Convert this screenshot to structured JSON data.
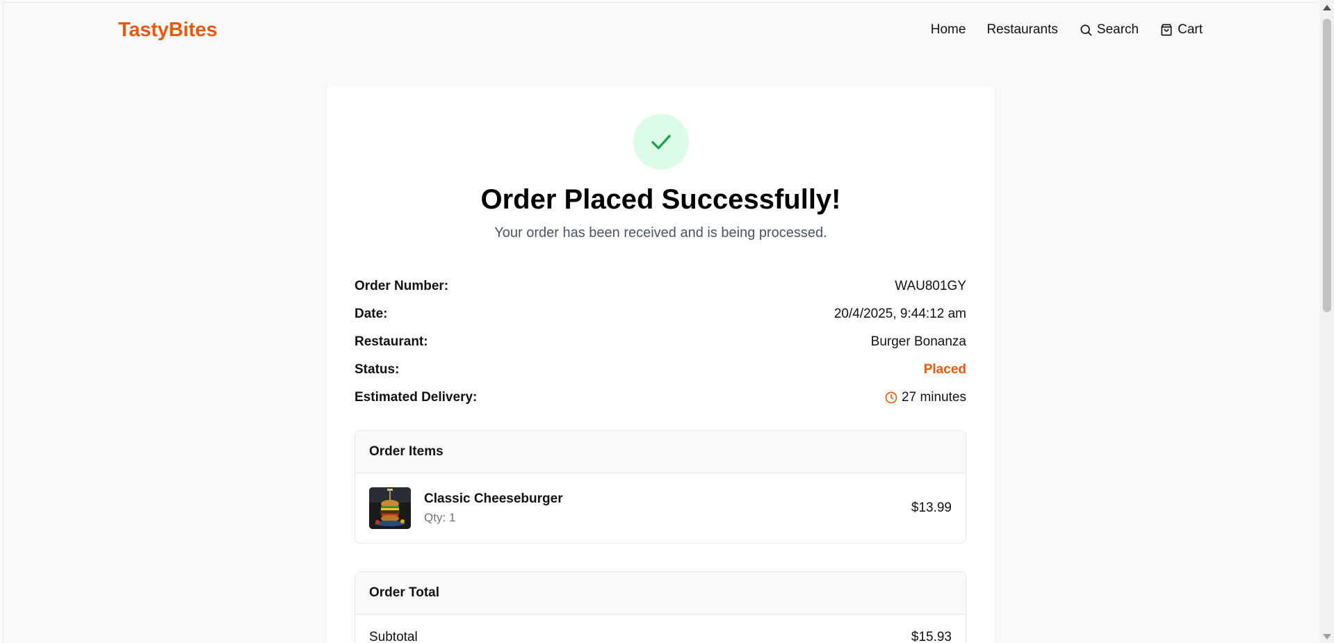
{
  "header": {
    "brand": "TastyBites",
    "nav": [
      {
        "label": "Home",
        "icon": ""
      },
      {
        "label": "Restaurants",
        "icon": ""
      },
      {
        "label": "Search",
        "icon": "search-icon"
      },
      {
        "label": "Cart",
        "icon": "shopping-bag-icon"
      }
    ]
  },
  "confirmation": {
    "icon": "check-icon",
    "title": "Order Placed Successfully!",
    "subtitle": "Your order has been received and is being processed."
  },
  "details": {
    "order_number_label": "Order Number:",
    "order_number": "WAU801GY",
    "date_label": "Date:",
    "date": "20/4/2025, 9:44:12 am",
    "restaurant_label": "Restaurant:",
    "restaurant": "Burger Bonanza",
    "status_label": "Status:",
    "status": "Placed",
    "eta_label": "Estimated Delivery:",
    "eta": "27 minutes"
  },
  "order_items": {
    "heading": "Order Items",
    "items": [
      {
        "name": "Classic Cheeseburger",
        "qty": "Qty: 1",
        "price": "$13.99"
      }
    ]
  },
  "order_total": {
    "heading": "Order Total",
    "subtotal_label": "Subtotal",
    "subtotal": "$15.93"
  },
  "colors": {
    "brand": "#e8590c",
    "success_bg": "#dcfce7",
    "success_check": "#16a34a",
    "status_placed": "#e8590c"
  }
}
